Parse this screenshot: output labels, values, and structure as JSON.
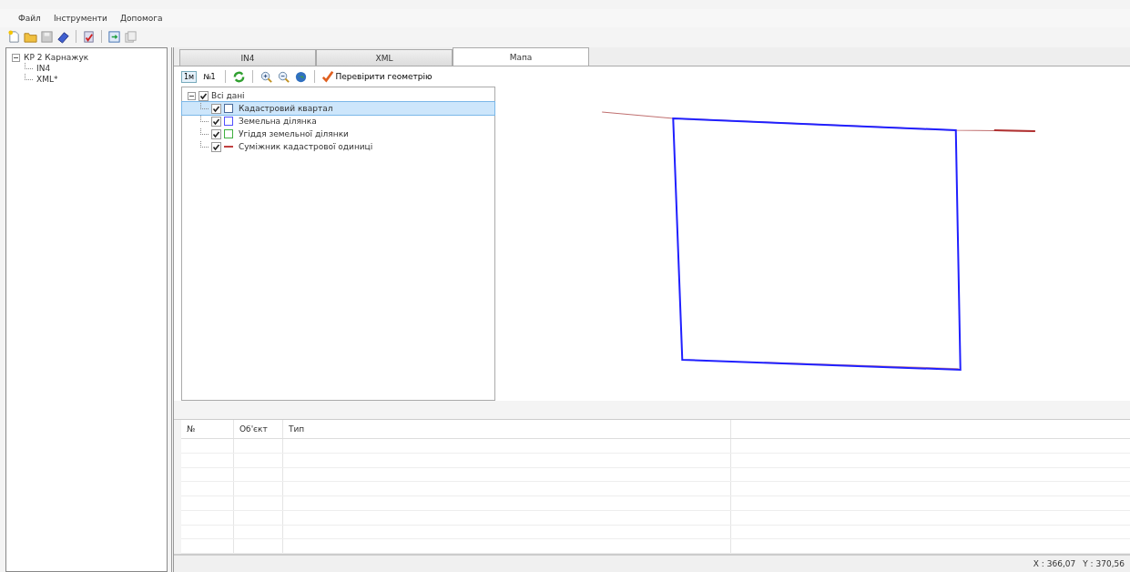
{
  "menu": [
    "Файл",
    "Інструменти",
    "Допомога"
  ],
  "tree": {
    "label": "КР 2 Карнажук",
    "expanded": true,
    "children": [
      {
        "label": "IN4"
      },
      {
        "label": "XML*"
      }
    ]
  },
  "tabs": [
    {
      "label": "IN4",
      "selected": false
    },
    {
      "label": "XML",
      "selected": false
    },
    {
      "label": "Мапа",
      "selected": true
    }
  ],
  "map_toolbar": {
    "buttons": [
      {
        "label": "1м",
        "selected": true
      },
      {
        "label": "№1",
        "selected": false
      }
    ],
    "check_label": "Перевірити геометрію"
  },
  "layers": {
    "label": "Всі дані",
    "checked": true,
    "expanded": true,
    "children": [
      {
        "label": "Кадастровий квартал",
        "checked": true,
        "selected": true,
        "kind": "square",
        "color": "#4a6a9a"
      },
      {
        "label": "Земельна ділянка",
        "checked": true,
        "selected": false,
        "kind": "square",
        "color": "#5050ff"
      },
      {
        "label": "Угіддя земельної ділянки",
        "checked": true,
        "selected": false,
        "kind": "square",
        "color": "#40b040"
      },
      {
        "label": "Суміжник кадастрової одиниці",
        "checked": true,
        "selected": false,
        "kind": "line",
        "color": "#c04040"
      }
    ]
  },
  "table": {
    "columns": [
      "№",
      "Об'єкт",
      "Тип"
    ]
  },
  "status_bar": {
    "x": "X : 366,07",
    "y": "Y : 370,56"
  }
}
